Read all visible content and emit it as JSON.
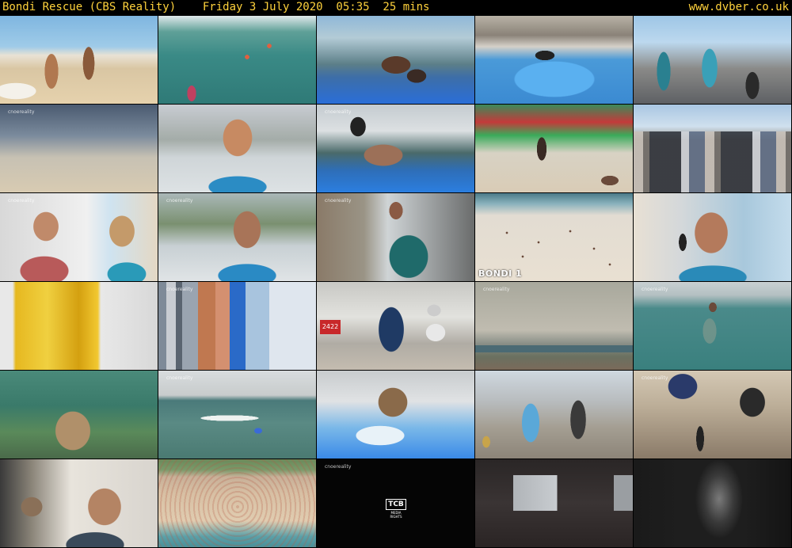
{
  "header": {
    "title": "Bondi Rescue (CBS Reality)    Friday 3 July 2020  05:35  25 mins",
    "site": "www.dvber.co.uk"
  },
  "colors": {
    "header_text": "#ffd23c",
    "background": "#000000"
  },
  "thumbnails": [
    {
      "scene": "beach-runners"
    },
    {
      "scene": "swimmers-in-surf"
    },
    {
      "scene": "rescue-board-rider"
    },
    {
      "scene": "skate-bowl-crowd"
    },
    {
      "scene": "lifeguards-on-deck"
    },
    {
      "scene": "sand-blur"
    },
    {
      "scene": "lifeguard-talking"
    },
    {
      "scene": "board-rescue-closeup"
    },
    {
      "scene": "graffiti-wall-beach"
    },
    {
      "scene": "building-pan-blur"
    },
    {
      "scene": "lifeguard-tower-laughing"
    },
    {
      "scene": "lifeguard-interview"
    },
    {
      "scene": "first-aid-room"
    },
    {
      "scene": "crowded-beach",
      "caption": "BONDI 1"
    },
    {
      "scene": "lifeguard-phone"
    },
    {
      "scene": "yellow-blur"
    },
    {
      "scene": "streaked-buildings"
    },
    {
      "scene": "police-arrest"
    },
    {
      "scene": "coastal-buildings"
    },
    {
      "scene": "swimmer-at-sea"
    },
    {
      "scene": "underwater-swimmer"
    },
    {
      "scene": "surfer-paddling"
    },
    {
      "scene": "board-rescue-wave"
    },
    {
      "scene": "promenade-walkers"
    },
    {
      "scene": "prosthetic-leg-chair"
    },
    {
      "scene": "man-at-desk"
    },
    {
      "scene": "packed-bondi-beach"
    },
    {
      "scene": "tcb-logo",
      "logo_text": "TCB",
      "logo_sub": "MEDIA RIGHTS"
    },
    {
      "scene": "dark-room-windows"
    },
    {
      "scene": "dark-corridor"
    }
  ]
}
